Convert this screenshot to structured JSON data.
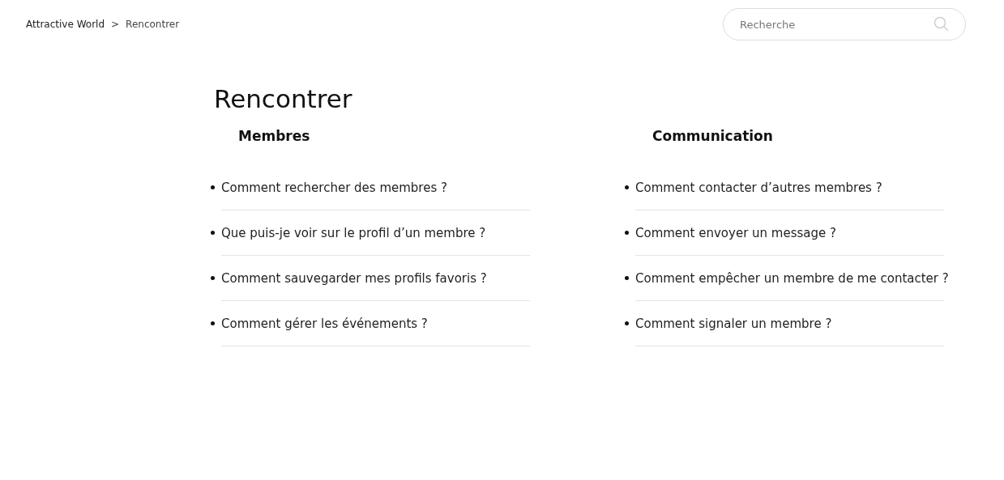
{
  "breadcrumb": [
    "Attractive World",
    ">",
    "Rencontrer"
  ],
  "search": {
    "placeholder": "Recherche"
  },
  "title": "Rencontrer",
  "sections": [
    {
      "heading": "Membres",
      "links": [
        "Comment rechercher des membres ?",
        "Que puis-je voir sur le profil d’un membre ?",
        "Comment sauvegarder mes profils favoris ?",
        "Comment gérer les événements ?"
      ]
    },
    {
      "heading": "Communication",
      "links": [
        "Comment contacter d’autres membres ?",
        "Comment envoyer un message ?",
        "Comment empêcher un membre de me contacter ?",
        "Comment signaler un membre ?"
      ]
    }
  ]
}
